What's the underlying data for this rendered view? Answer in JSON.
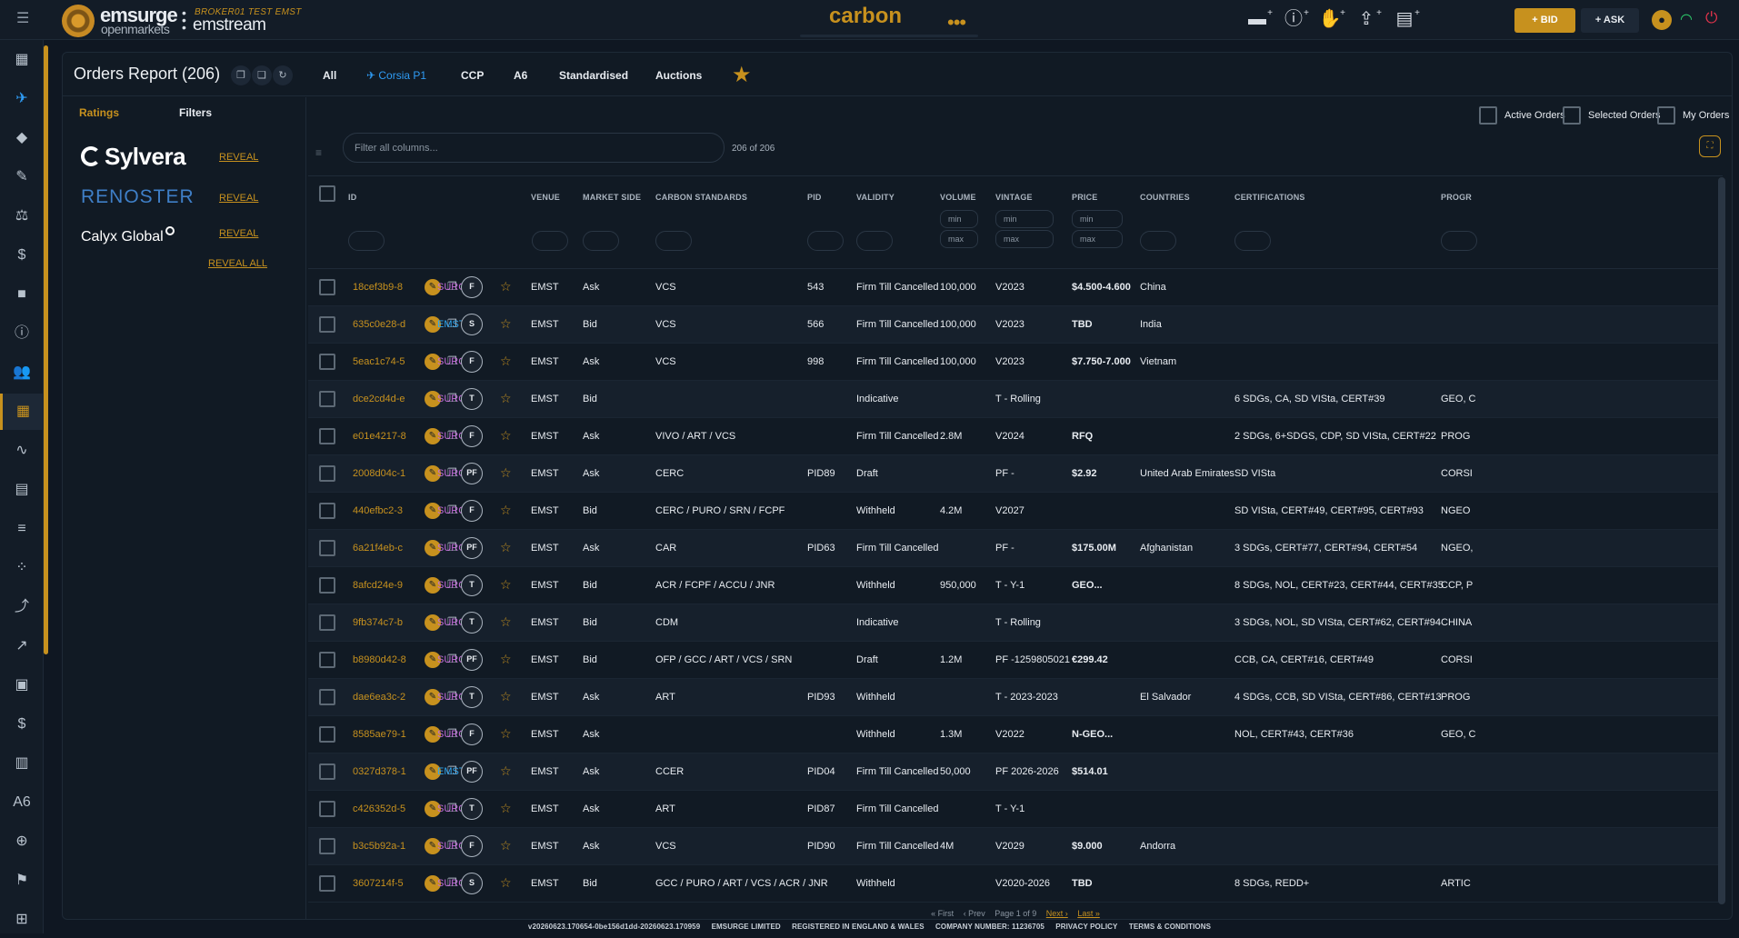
{
  "header": {
    "brand_name": "emsurge",
    "brand_sub": "openmarkets",
    "broker_label": "BROKER01 TEST EMST",
    "brand2": "emstream",
    "product": "carbon",
    "more": "•••",
    "bid_label": "+ BID",
    "ask_label": "+ ASK",
    "icons": [
      "add-folder-icon",
      "info-plus-icon",
      "handshake-icon",
      "upload-icon",
      "report-plus-icon"
    ]
  },
  "sidenav": {
    "icons": [
      "dashboard-icon",
      "plane-icon",
      "tag-icon",
      "document-edit-icon",
      "scale-icon",
      "route-icon",
      "folder-icon",
      "info-icon",
      "users-icon",
      "table-icon",
      "analytics-icon",
      "list-doc-icon",
      "list-icon",
      "scatter-icon",
      "trend-icon",
      "line-chart-icon",
      "briefcase-icon",
      "dollar-icon",
      "bar-chart-icon",
      "a6-icon",
      "globe-icon",
      "flag-icon",
      "grid-icon"
    ]
  },
  "report": {
    "title": "Orders Report (206)",
    "tabs": [
      "All",
      "Corsia P1",
      "CCP",
      "A6",
      "Standardised",
      "Auctions"
    ],
    "active_tab": "Corsia P1"
  },
  "left_panel": {
    "tabs": [
      "Ratings",
      "Filters"
    ],
    "ratings": [
      {
        "name": "Sylvera",
        "action": "REVEAL"
      },
      {
        "name": "RENOSTER",
        "action": "REVEAL"
      },
      {
        "name": "Calyx Global",
        "action": "REVEAL"
      }
    ],
    "reveal_all": "REVEAL ALL"
  },
  "toolbar": {
    "active_orders": "Active Orders",
    "selected_orders": "Selected Orders",
    "my_orders": "My Orders",
    "filter_placeholder": "Filter all columns...",
    "count": "206 of 206"
  },
  "grid": {
    "columns": {
      "id": "ID",
      "venue": "VENUE",
      "market_side": "MARKET SIDE",
      "carbon_standards": "CARBON STANDARDS",
      "pid": "PID",
      "validity": "VALIDITY",
      "volume": "VOLUME",
      "vintage": "VINTAGE",
      "price": "PRICE",
      "countries": "COUNTRIES",
      "certifications": "CERTIFICATIONS",
      "programs": "PROGR"
    },
    "min_label": "min",
    "max_label": "max",
    "rows": [
      {
        "id": "18cef3b9-8",
        "tag": "SURG",
        "badge": "F",
        "venue": "EMST",
        "side": "Ask",
        "standards": "VCS",
        "pid": "543",
        "validity": "Firm Till Cancelled",
        "volume": "100,000",
        "vintage": "V2023",
        "price": "$4.500-4.600",
        "countries": "China",
        "certs": "",
        "prog": ""
      },
      {
        "id": "635c0e28-d",
        "tag": "EMST",
        "badge": "S",
        "venue": "EMST",
        "side": "Bid",
        "standards": "VCS",
        "pid": "566",
        "validity": "Firm Till Cancelled",
        "volume": "100,000",
        "vintage": "V2023",
        "price": "TBD",
        "countries": "India",
        "certs": "",
        "prog": ""
      },
      {
        "id": "5eac1c74-5",
        "tag": "SURG",
        "badge": "F",
        "venue": "EMST",
        "side": "Ask",
        "standards": "VCS",
        "pid": "998",
        "validity": "Firm Till Cancelled",
        "volume": "100,000",
        "vintage": "V2023",
        "price": "$7.750-7.000",
        "countries": "Vietnam",
        "certs": "",
        "prog": ""
      },
      {
        "id": "dce2cd4d-e",
        "tag": "SURG",
        "badge": "T",
        "venue": "EMST",
        "side": "Bid",
        "standards": "",
        "pid": "",
        "validity": "Indicative",
        "volume": "",
        "vintage": "T - Rolling",
        "price": "",
        "countries": "",
        "certs": "6 SDGs, CA, SD VISta, CERT#39",
        "prog": "GEO, C"
      },
      {
        "id": "e01e4217-8",
        "tag": "SURG",
        "badge": "F",
        "venue": "EMST",
        "side": "Ask",
        "standards": "VIVO / ART / VCS",
        "pid": "",
        "validity": "Firm Till Cancelled",
        "volume": "2.8M",
        "vintage": "V2024",
        "price": "RFQ",
        "countries": "",
        "certs": "2 SDGs, 6+SDGS, CDP, SD VISta, CERT#22",
        "prog": "PROG"
      },
      {
        "id": "2008d04c-1",
        "tag": "SURG",
        "badge": "PF",
        "venue": "EMST",
        "side": "Ask",
        "standards": "CERC",
        "pid": "PID89",
        "validity": "Draft",
        "volume": "",
        "vintage": "PF -",
        "price": "$2.92",
        "countries": "United Arab Emirates",
        "certs": "SD VISta",
        "prog": "CORSI"
      },
      {
        "id": "440efbc2-3",
        "tag": "SURG",
        "badge": "F",
        "venue": "EMST",
        "side": "Bid",
        "standards": "CERC / PURO / SRN / FCPF",
        "pid": "",
        "validity": "Withheld",
        "volume": "4.2M",
        "vintage": "V2027",
        "price": "",
        "countries": "",
        "certs": "SD VISta, CERT#49, CERT#95, CERT#93",
        "prog": "NGEO"
      },
      {
        "id": "6a21f4eb-c",
        "tag": "SURG",
        "badge": "PF",
        "venue": "EMST",
        "side": "Ask",
        "standards": "CAR",
        "pid": "PID63",
        "validity": "Firm Till Cancelled",
        "volume": "",
        "vintage": "PF -",
        "price": "$175.00M",
        "countries": "Afghanistan",
        "certs": "3 SDGs, CERT#77, CERT#94, CERT#54",
        "prog": "NGEO,"
      },
      {
        "id": "8afcd24e-9",
        "tag": "SURG",
        "badge": "T",
        "venue": "EMST",
        "side": "Bid",
        "standards": "ACR / FCPF / ACCU / JNR",
        "pid": "",
        "validity": "Withheld",
        "volume": "950,000",
        "vintage": "T - Y-1",
        "price": "GEO...",
        "countries": "",
        "certs": "8 SDGs, NOL, CERT#23, CERT#44, CERT#35",
        "prog": "CCP, P"
      },
      {
        "id": "9fb374c7-b",
        "tag": "SURG",
        "badge": "T",
        "venue": "EMST",
        "side": "Bid",
        "standards": "CDM",
        "pid": "",
        "validity": "Indicative",
        "volume": "",
        "vintage": "T - Rolling",
        "price": "",
        "countries": "",
        "certs": "3 SDGs, NOL, SD VISta, CERT#62, CERT#94",
        "prog": "CHINA"
      },
      {
        "id": "b8980d42-8",
        "tag": "SURG",
        "badge": "PF",
        "venue": "EMST",
        "side": "Bid",
        "standards": "OFP / GCC / ART / VCS / SRN",
        "pid": "",
        "validity": "Draft",
        "volume": "1.2M",
        "vintage": "PF -1259805021",
        "price": "€299.42",
        "countries": "",
        "certs": "CCB, CA, CERT#16, CERT#49",
        "prog": "CORSI"
      },
      {
        "id": "dae6ea3c-2",
        "tag": "SURG",
        "badge": "T",
        "venue": "EMST",
        "side": "Ask",
        "standards": "ART",
        "pid": "PID93",
        "validity": "Withheld",
        "volume": "",
        "vintage": "T - 2023-2023",
        "price": "",
        "countries": "El Salvador",
        "certs": "4 SDGs, CCB, SD VISta, CERT#86, CERT#13",
        "prog": "PROG"
      },
      {
        "id": "8585ae79-1",
        "tag": "SURG",
        "badge": "F",
        "venue": "EMST",
        "side": "Ask",
        "standards": "",
        "pid": "",
        "validity": "Withheld",
        "volume": "1.3M",
        "vintage": "V2022",
        "price": "N-GEO...",
        "countries": "",
        "certs": "NOL, CERT#43, CERT#36",
        "prog": "GEO, C"
      },
      {
        "id": "0327d378-1",
        "tag": "EMST",
        "badge": "PF",
        "venue": "EMST",
        "side": "Ask",
        "standards": "CCER",
        "pid": "PID04",
        "validity": "Firm Till Cancelled",
        "volume": "50,000",
        "vintage": "PF 2026-2026",
        "price": "$514.01",
        "countries": "",
        "certs": "",
        "prog": ""
      },
      {
        "id": "c426352d-5",
        "tag": "SURG",
        "badge": "T",
        "venue": "EMST",
        "side": "Ask",
        "standards": "ART",
        "pid": "PID87",
        "validity": "Firm Till Cancelled",
        "volume": "",
        "vintage": "T - Y-1",
        "price": "",
        "countries": "",
        "certs": "",
        "prog": ""
      },
      {
        "id": "b3c5b92a-1",
        "tag": "SURG",
        "badge": "F",
        "venue": "EMST",
        "side": "Ask",
        "standards": "VCS",
        "pid": "PID90",
        "validity": "Firm Till Cancelled",
        "volume": "4M",
        "vintage": "V2029",
        "price": "$9.000",
        "countries": "Andorra",
        "certs": "",
        "prog": ""
      },
      {
        "id": "3607214f-5",
        "tag": "SURG",
        "badge": "S",
        "venue": "EMST",
        "side": "Bid",
        "standards": "GCC / PURO / ART / VCS / ACR / JNR",
        "pid": "",
        "validity": "Withheld",
        "volume": "",
        "vintage": "V2020-2026",
        "price": "TBD",
        "countries": "",
        "certs": "8 SDGs, REDD+",
        "prog": "ARTIC"
      }
    ]
  },
  "pager": {
    "first": "« First",
    "prev": "‹ Prev",
    "page": "Page 1 of 9",
    "next": "Next ›",
    "last": "Last »"
  },
  "footer": {
    "version": "v20260623.170654-0be156d1dd-20260623.170959",
    "company": "EMSURGE LIMITED",
    "registered": "REGISTERED IN ENGLAND & WALES",
    "company_number": "COMPANY NUMBER: 11236705",
    "privacy": "PRIVACY POLICY",
    "terms": "TERMS & CONDITIONS"
  },
  "colors": {
    "accent": "#c7911e",
    "link_blue": "#2f9cf5",
    "surg": "#c26bd8",
    "emst": "#2fa7f0"
  }
}
